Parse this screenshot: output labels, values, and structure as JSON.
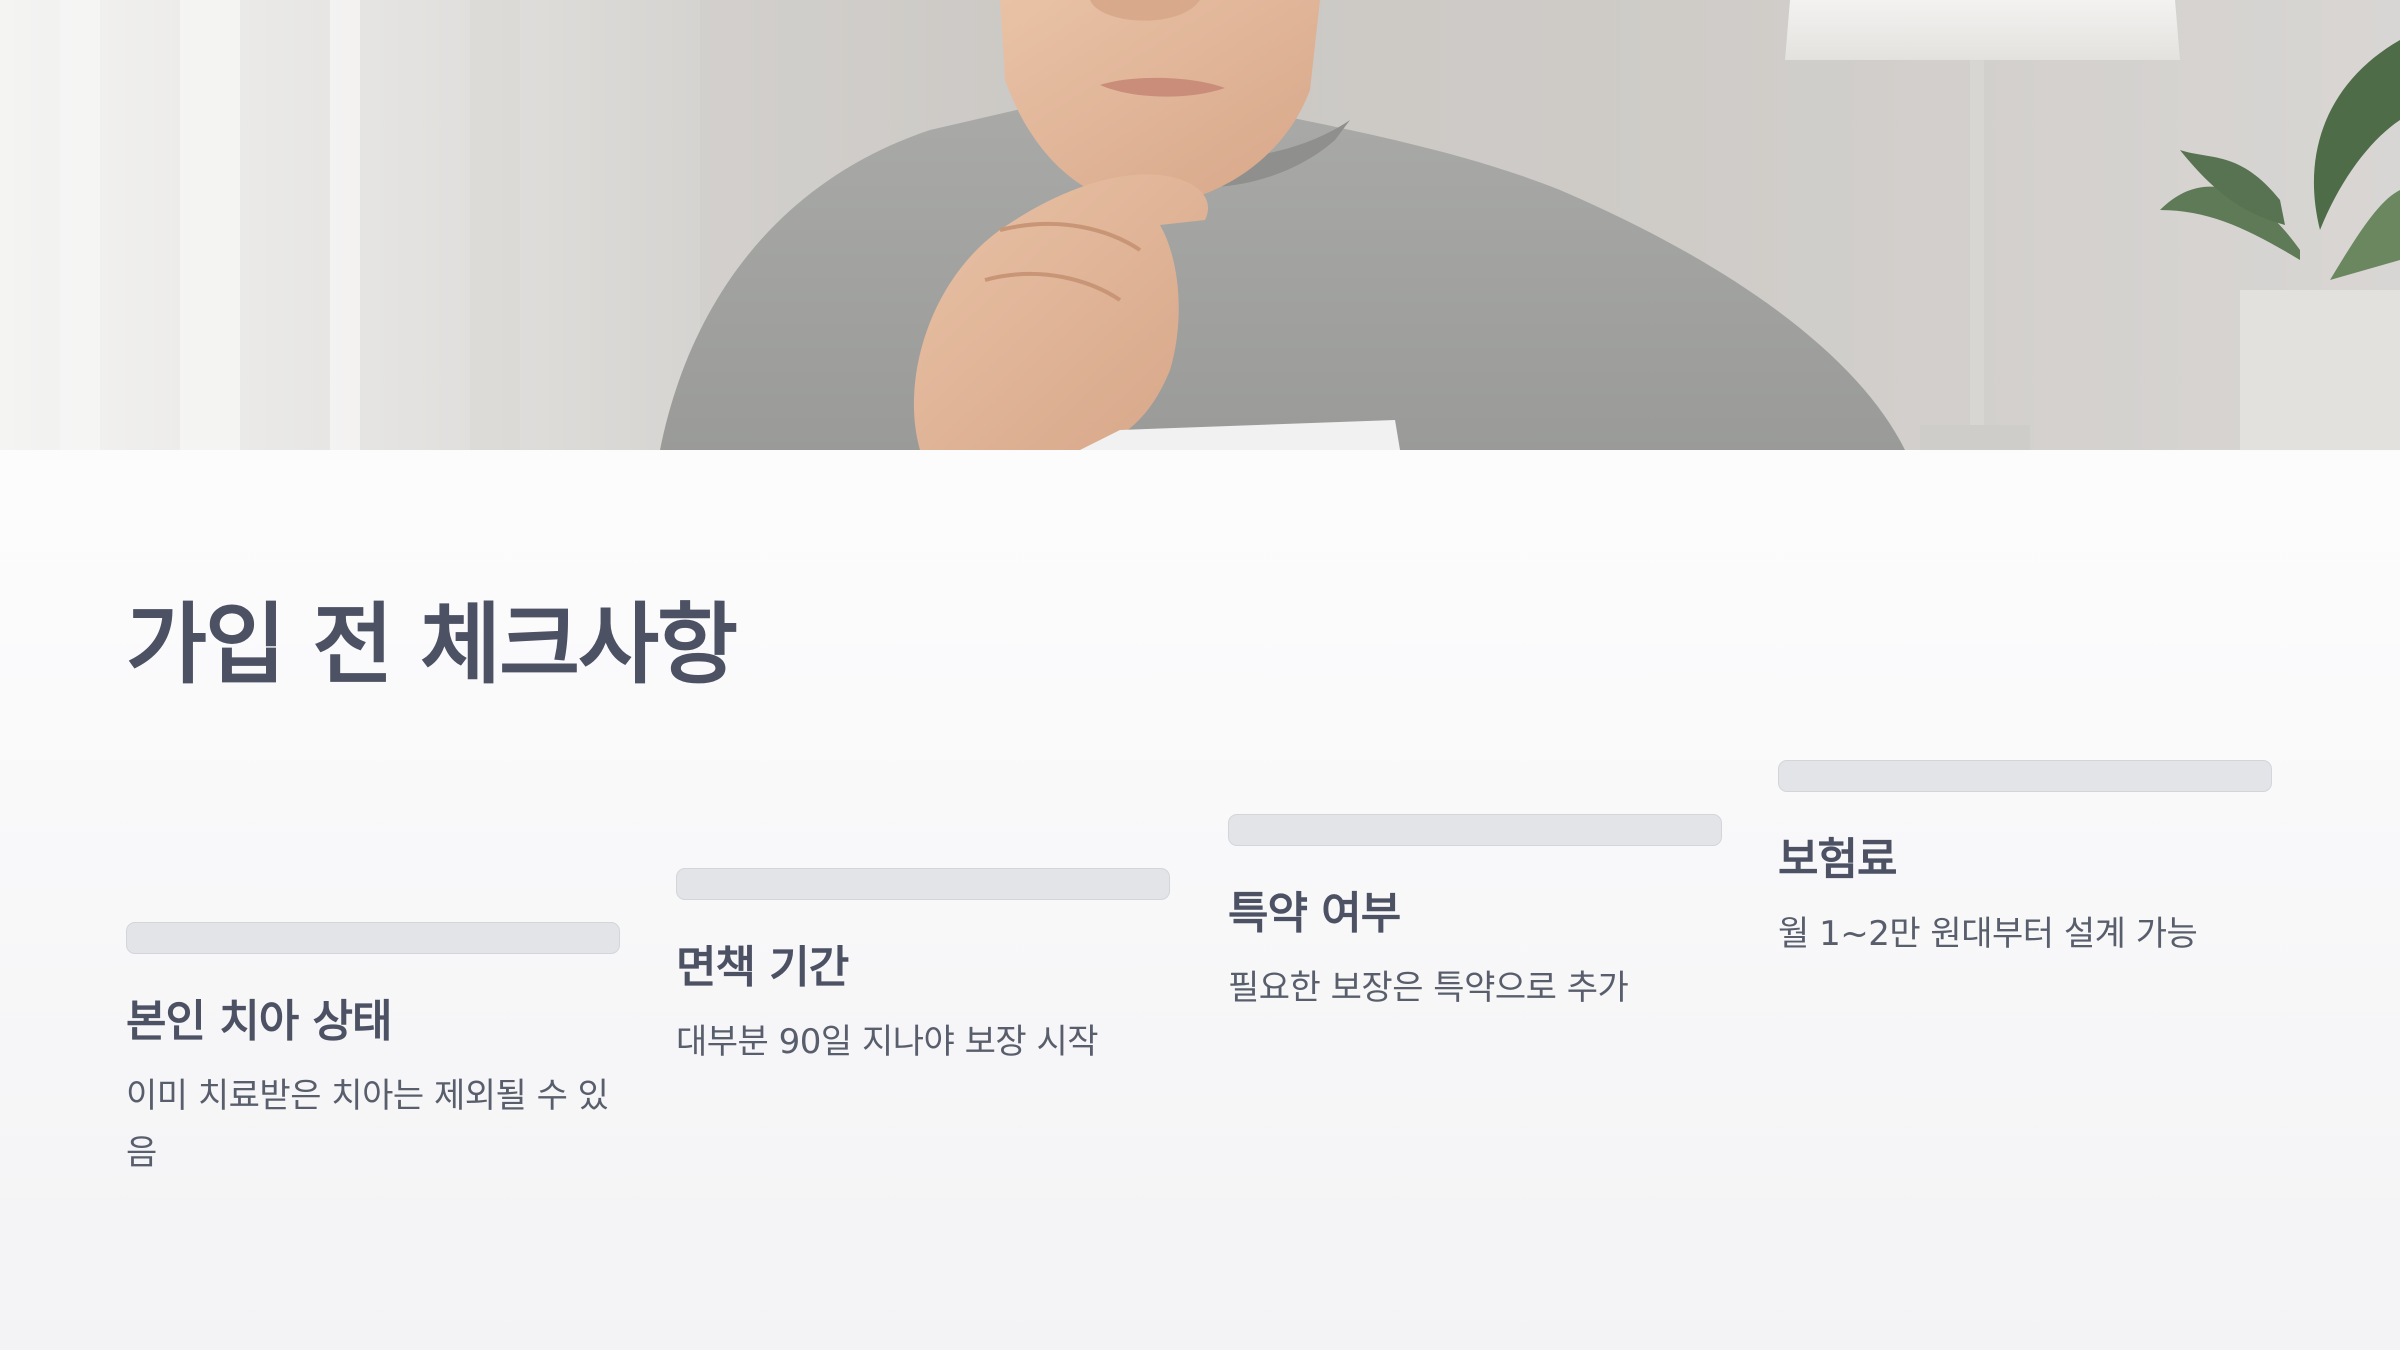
{
  "slide": {
    "title": "가입 전 체크사항",
    "hero_image": "person-reviewing-document-photo",
    "accent_color": "#4c5163",
    "bar_color": "#e3e4e8",
    "steps": [
      {
        "title": "본인 치아 상태",
        "description": "이미 치료받은 치아는 제외될 수 있음"
      },
      {
        "title": "면책 기간",
        "description": "대부분 90일 지나야 보장 시작"
      },
      {
        "title": "특약 여부",
        "description": "필요한 보장은 특약으로 추가"
      },
      {
        "title": "보험료",
        "description": "월 1~2만 원대부터 설계 가능"
      }
    ]
  }
}
